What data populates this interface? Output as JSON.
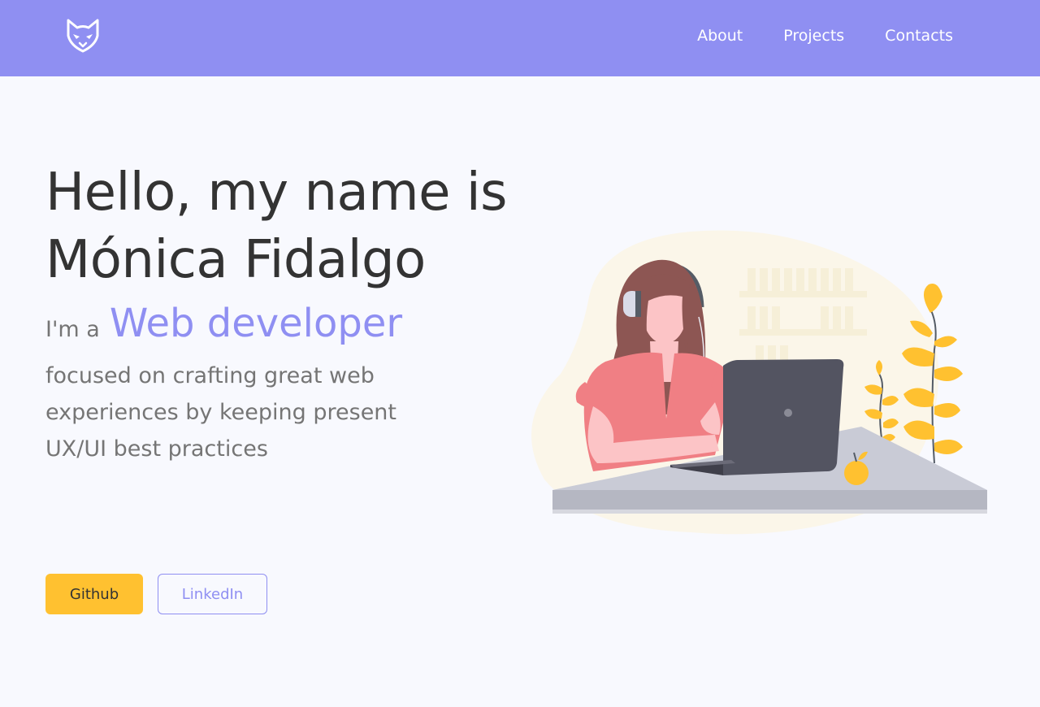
{
  "nav": {
    "links": [
      {
        "label": "About"
      },
      {
        "label": "Projects"
      },
      {
        "label": "Contacts"
      }
    ]
  },
  "hero": {
    "title": "Hello, my name is Mónica Fidalgo",
    "role_prefix": "I'm a",
    "role_title": "Web developer",
    "description": "focused on crafting great web experiences by keeping present UX/UI best practices"
  },
  "buttons": {
    "github": "Github",
    "linkedin": "LinkedIn"
  },
  "colors": {
    "navbar": "#8f8ff2",
    "accent": "#8f8ff2",
    "github_button": "#ffc130",
    "title_text": "#333333",
    "body_text": "#757575",
    "background": "#f8f9fe"
  }
}
